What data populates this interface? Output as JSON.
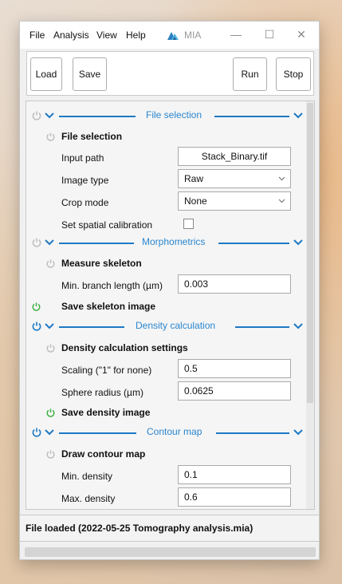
{
  "menubar": {
    "items": [
      "File",
      "Analysis",
      "View",
      "Help"
    ],
    "app_title": "MIA",
    "minimize_symbol": "—",
    "maximize_symbol": "☐",
    "close_symbol": "✕"
  },
  "toolbar": {
    "load_label": "Load",
    "save_label": "Save",
    "run_label": "Run",
    "stop_label": "Stop"
  },
  "colors": {
    "accent": "#1d79c4",
    "enabled": "#3cb043",
    "disabled": "#bdbdbd"
  },
  "sections": {
    "file_selection": {
      "header": "File selection",
      "module": "File selection",
      "input_path_label": "Input path",
      "input_path_value": "Stack_Binary.tif",
      "image_type_label": "Image type",
      "image_type_value": "Raw",
      "crop_mode_label": "Crop mode",
      "crop_mode_value": "None",
      "spatial_label": "Set spatial calibration",
      "spatial_checked": false
    },
    "morphometrics": {
      "header": "Morphometrics",
      "module": "Measure skeleton",
      "min_branch_label": "Min. branch length (µm)",
      "min_branch_value": "0.003",
      "save_module": "Save skeleton image"
    },
    "density": {
      "header": "Density calculation",
      "module": "Density calculation settings",
      "scaling_label": "Scaling (\"1\" for none)",
      "scaling_value": "0.5",
      "sphere_label": "Sphere radius (µm)",
      "sphere_value": "0.0625",
      "save_module": "Save density image"
    },
    "contour": {
      "header": "Contour map",
      "module": "Draw contour map",
      "min_density_label": "Min. density",
      "min_density_value": "0.1",
      "max_density_label": "Max. density",
      "max_density_value": "0.6"
    }
  },
  "status": {
    "text": "File loaded (2022-05-25 Tomography analysis.mia)"
  }
}
